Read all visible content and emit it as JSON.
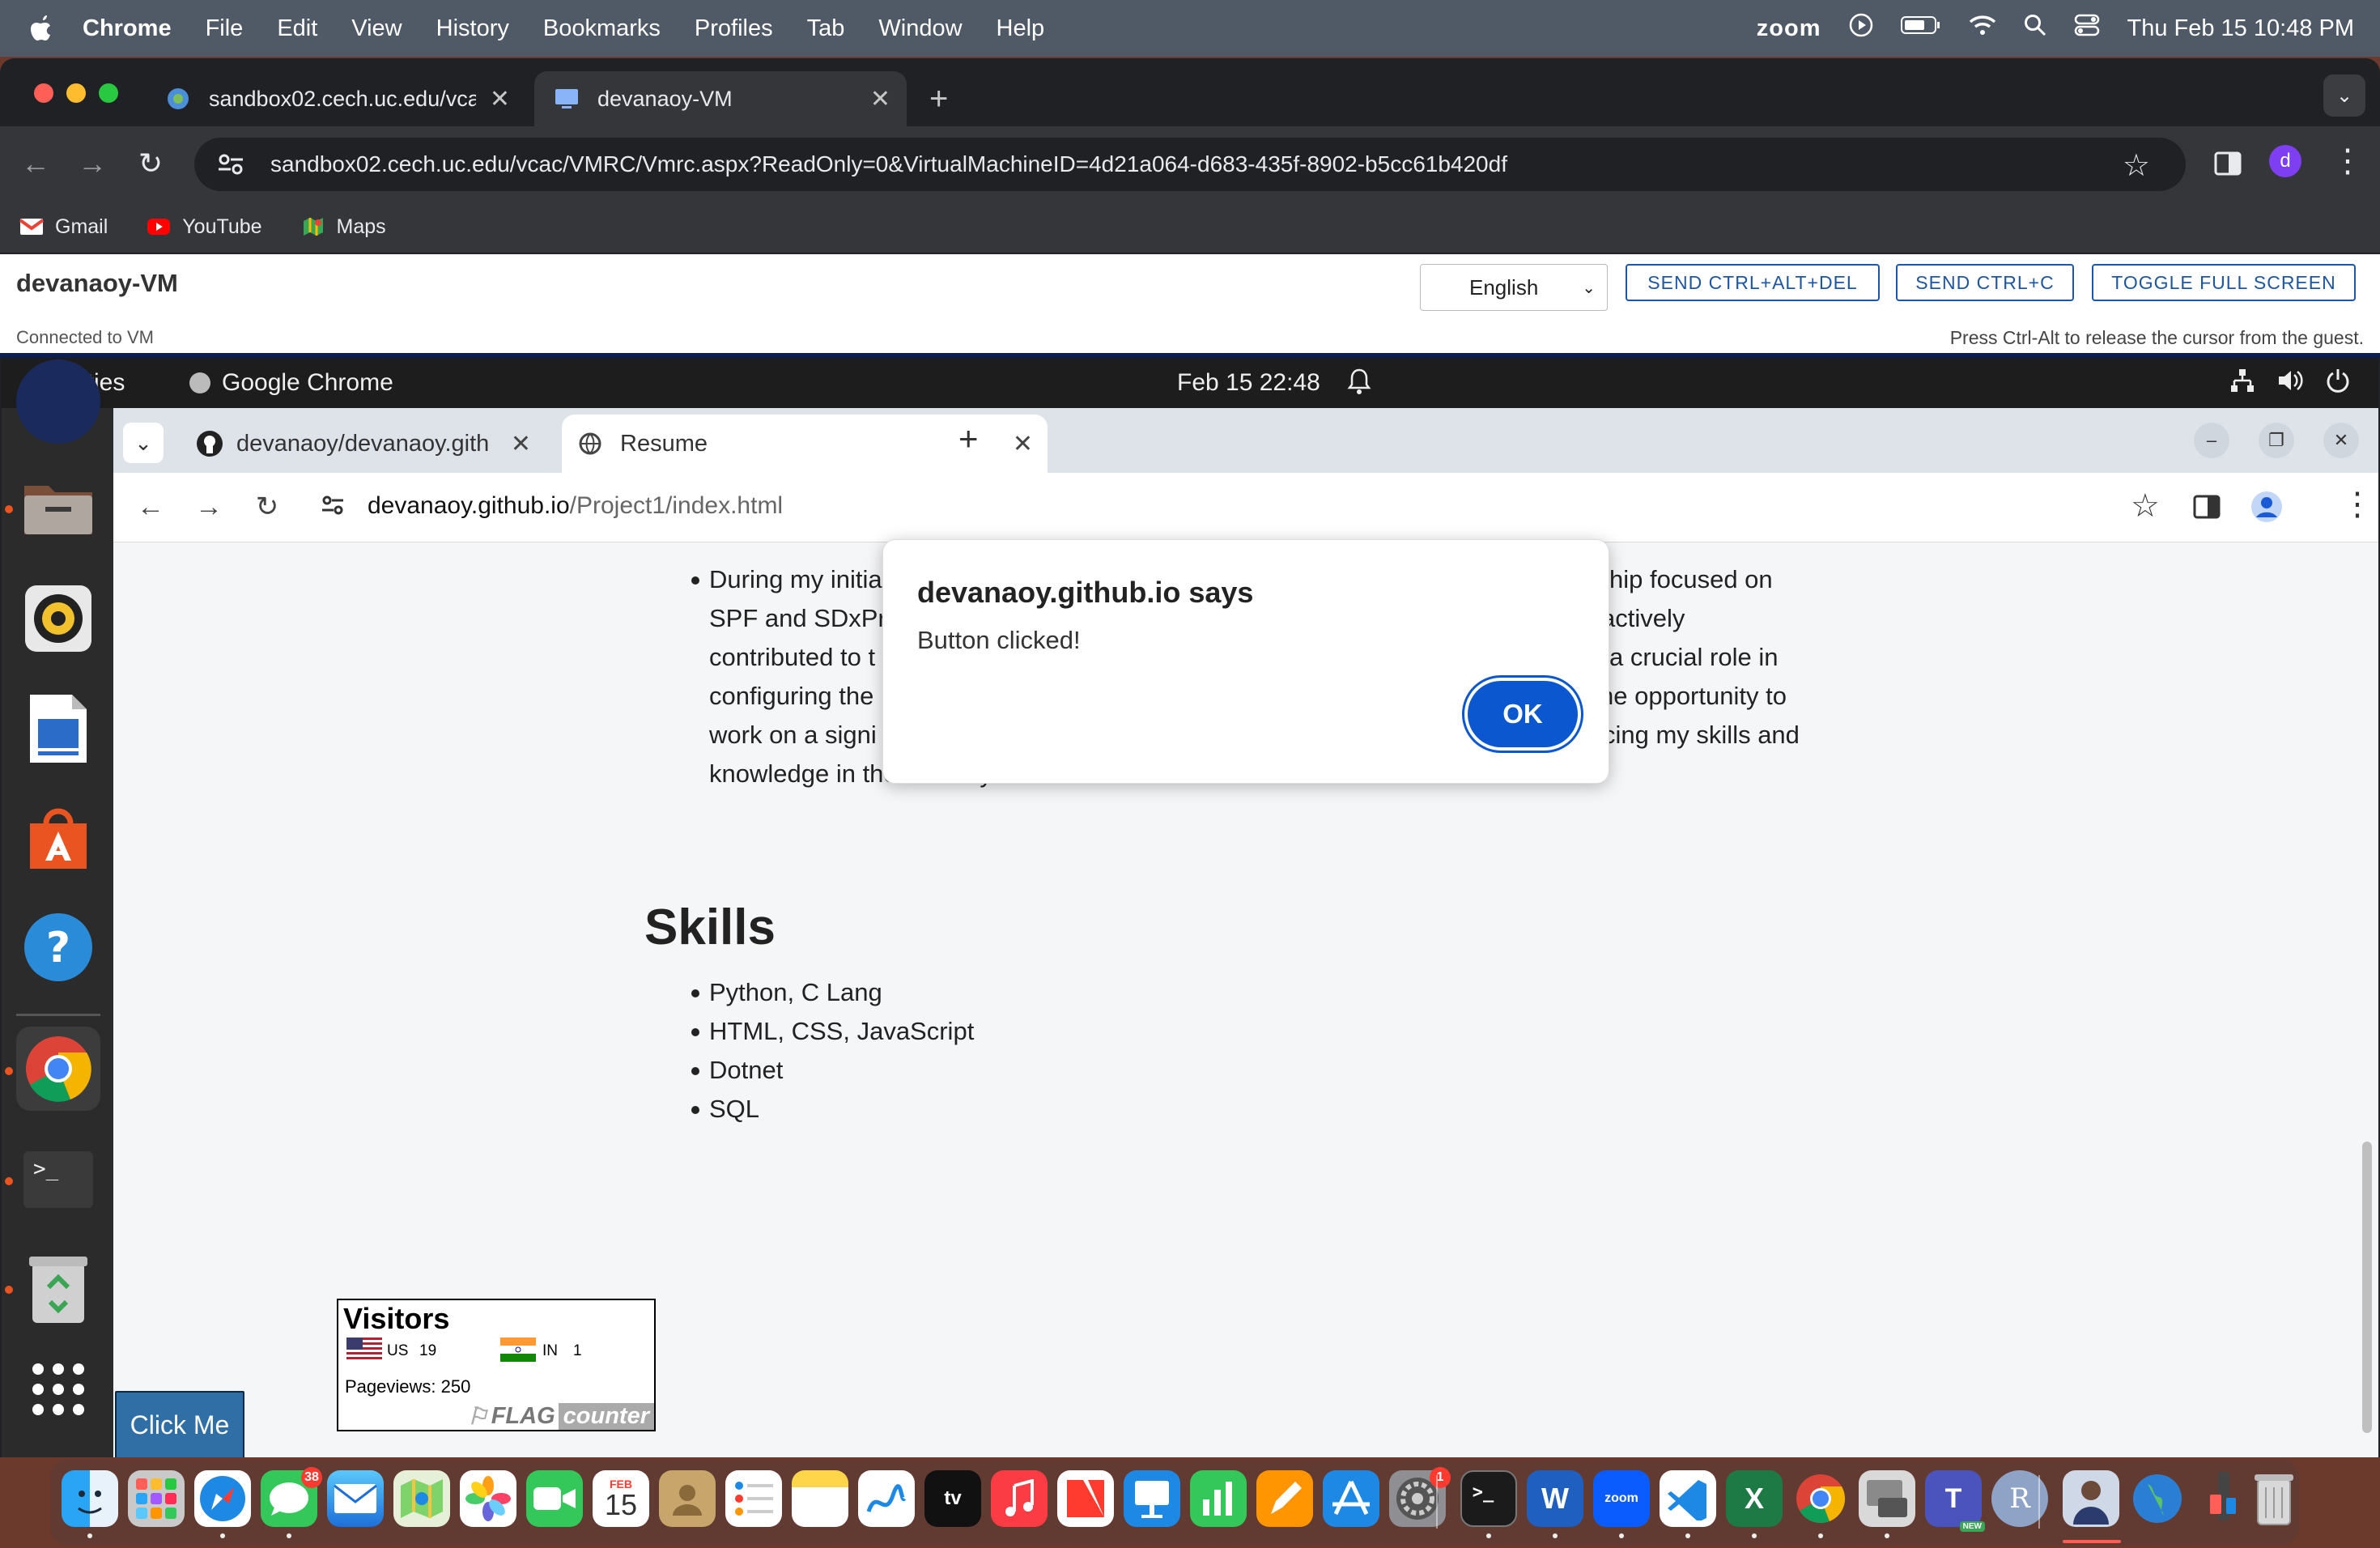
{
  "mac_menubar": {
    "app_name": "Chrome",
    "menus": [
      "File",
      "Edit",
      "View",
      "History",
      "Bookmarks",
      "Profiles",
      "Tab",
      "Window",
      "Help"
    ],
    "zoom_label": "zoom",
    "datetime": "Thu Feb 15  10:48 PM"
  },
  "host_browser": {
    "tabs": [
      {
        "title": "sandbox02.cech.uc.edu/vcac",
        "icon": "globe-icon"
      },
      {
        "title": "devanaoy-VM",
        "icon": "monitor-icon"
      }
    ],
    "url": "sandbox02.cech.uc.edu/vcac/VMRC/Vmrc.aspx?ReadOnly=0&VirtualMachineID=4d21a064-d683-435f-8902-b5cc61b420df",
    "profile_initial": "d",
    "bookmarks": [
      {
        "label": "Gmail",
        "icon": "gmail-icon"
      },
      {
        "label": "YouTube",
        "icon": "youtube-icon"
      },
      {
        "label": "Maps",
        "icon": "maps-icon"
      }
    ]
  },
  "vmrc": {
    "vm_name": "devanaoy-VM",
    "status": "Connected to VM",
    "language": "English",
    "btn_ctrl_alt_del": "SEND CTRL+ALT+DEL",
    "btn_ctrl_c": "SEND CTRL+C",
    "btn_fullscreen": "TOGGLE FULL SCREEN",
    "hint": "Press Ctrl-Alt to release the cursor from the guest."
  },
  "guest_topbar": {
    "activities": "Activities",
    "app": "Google Chrome",
    "clock": "Feb 15  22:48"
  },
  "guest_browser": {
    "tabs": [
      {
        "title": "devanaoy/devanaoy.gith",
        "icon": "github-icon"
      },
      {
        "title": "Resume",
        "icon": "globe-icon"
      }
    ],
    "url_host": "devanaoy.github.io",
    "url_path": "/Project1/index.html"
  },
  "page": {
    "paragraph_lines": [
      {
        "left": "During my initia",
        "right": "hip focused on"
      },
      {
        "left": "SPF and SDxPr",
        "right": "actively"
      },
      {
        "left": "contributed to t",
        "right": "a crucial role in"
      },
      {
        "left": "configuring the",
        "right": "he opportunity to"
      },
      {
        "left": "work on a signi",
        "right": "cing my skills and"
      },
      {
        "left": "knowledge in the industry.",
        "right": ""
      }
    ],
    "skills_heading": "Skills",
    "skills": [
      "Python, C Lang",
      "HTML, CSS, JavaScript",
      "Dotnet",
      "SQL"
    ],
    "flag_counter": {
      "title": "Visitors",
      "countries": [
        {
          "code": "US",
          "count": "19"
        },
        {
          "code": "IN",
          "count": "1"
        }
      ],
      "pageviews_label": "Pageviews:",
      "pageviews": "250",
      "brand_flag": "FLAG",
      "brand_counter": "counter"
    },
    "click_me_label": "Click Me"
  },
  "alert": {
    "title": "devanaoy.github.io says",
    "message": "Button clicked!",
    "ok_label": "OK"
  },
  "mac_dock": {
    "messages_badge": "38",
    "calendar_month": "FEB",
    "calendar_day": "15",
    "settings_badge": "1",
    "tv_label": "tv",
    "zoom_label": "zoom",
    "teams_new": "NEW"
  }
}
